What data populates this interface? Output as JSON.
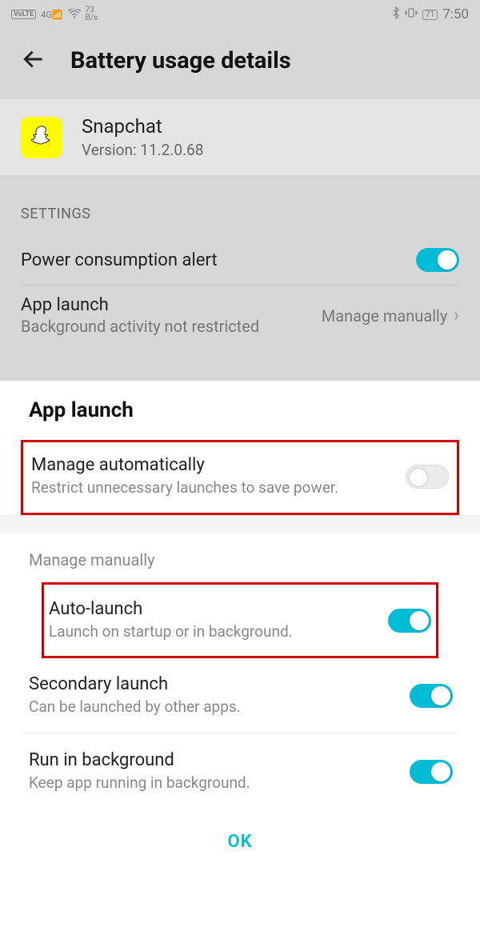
{
  "status": {
    "volte": "VoLTE",
    "signal": "4G",
    "rate_top": "73",
    "rate_bottom": "B/s",
    "battery_pct": "71",
    "time": "7:50"
  },
  "header": {
    "title": "Battery usage details"
  },
  "app": {
    "name": "Snapchat",
    "version": "Version: 11.2.0.68"
  },
  "settings_label": "SETTINGS",
  "power_alert": {
    "label": "Power consumption alert"
  },
  "app_launch_row": {
    "title": "App launch",
    "sub": "Background activity not restricted",
    "action": "Manage manually"
  },
  "sheet": {
    "title": "App launch",
    "auto": {
      "title": "Manage automatically",
      "desc": "Restrict unnecessary launches to save power."
    },
    "manual_label": "Manage manually",
    "items": [
      {
        "title": "Auto-launch",
        "desc": "Launch on startup or in background."
      },
      {
        "title": "Secondary launch",
        "desc": "Can be launched by other apps."
      },
      {
        "title": "Run in background",
        "desc": "Keep app running in background."
      }
    ],
    "ok": "OK"
  }
}
